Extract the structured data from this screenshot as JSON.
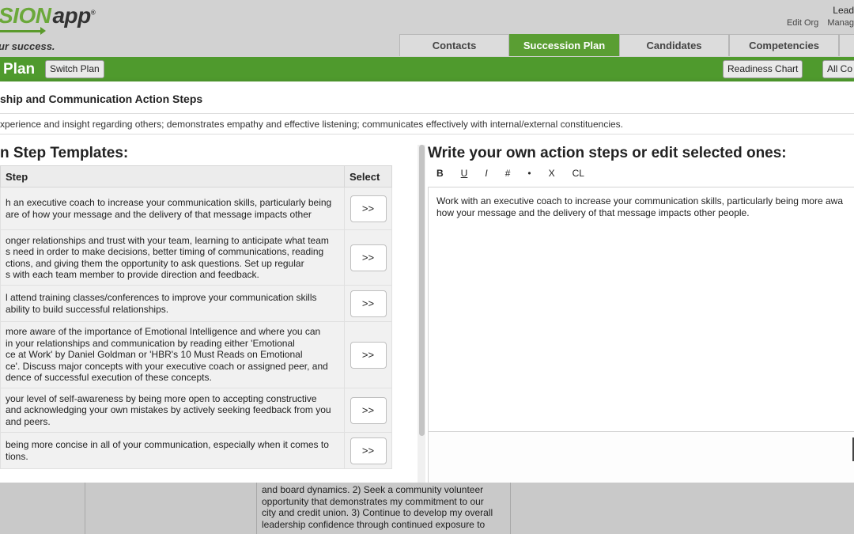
{
  "header": {
    "logo_main": "SION",
    "logo_app": "app",
    "tagline": "ur success.",
    "user_label": "Lead",
    "links": [
      "Edit Org",
      "Manag"
    ],
    "tabs": [
      "Contacts",
      "Succession Plan",
      "Candidates",
      "Competencies"
    ],
    "active_tab": "Succession Plan"
  },
  "toolbar": {
    "plan_title": "Plan",
    "switch_plan_label": "Switch Plan",
    "readiness_chart_label": "Readiness Chart",
    "all_label": "All Co"
  },
  "modal": {
    "title": "ship and Communication Action Steps",
    "description": "xperience and insight regarding others; demonstrates empathy and effective listening; communicates effectively with internal/external constituencies.",
    "left_heading": "n Step Templates:",
    "right_heading": "Write your own action steps or edit selected ones:",
    "table_headers": {
      "step": "Step",
      "select": "Select"
    },
    "add_button_label": ">>",
    "templates": [
      {
        "text": "h an executive coach to increase your communication skills, particularly being\nare of how your message and the delivery of that message impacts other"
      },
      {
        "text": "onger relationships and trust with your team, learning to anticipate what team\ns need in order to make decisions, better timing of communications, reading\nctions, and giving them the opportunity to ask questions. Set up regular\ns with each team member to provide direction and feedback."
      },
      {
        "text": "l attend training classes/conferences to improve your communication skills\nability to build successful relationships."
      },
      {
        "text": "more aware of the importance of Emotional Intelligence and where you can\nin your relationships and communication by reading either 'Emotional\nce at Work' by Daniel Goldman or 'HBR's 10 Must Reads on Emotional\nce'. Discuss major concepts with your executive coach or assigned peer, and\ndence of successful execution of these concepts."
      },
      {
        "text": "your level of self-awareness by being more open to accepting constructive\nand acknowledging your own mistakes by actively seeking feedback from you\nand peers."
      },
      {
        "text": "being more concise in all of your communication, especially when it comes to\ntions."
      }
    ],
    "editor": {
      "format_buttons": [
        "B",
        "U",
        "I",
        "#",
        "•",
        "X",
        "CL"
      ],
      "content": "Work with an executive coach to increase your communication skills, particularly being more awa\nhow your message and the delivery of that message impacts other people."
    }
  },
  "background": {
    "cell_text": "and board dynamics. 2) Seek a community volunteer\nopportunity that demonstrates my commitment to our\ncity and credit union. 3) Continue to develop my overall\nleadership confidence through continued exposure to"
  }
}
